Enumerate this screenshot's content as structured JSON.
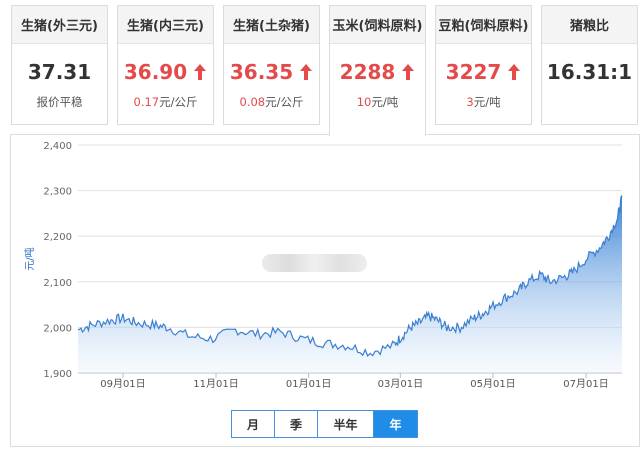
{
  "tabs": [
    {
      "title": "生猪(外三元)",
      "price": "37.31",
      "change": "",
      "unit": "报价平稳",
      "trend": "flat"
    },
    {
      "title": "生猪(内三元)",
      "price": "36.90",
      "change": "0.17",
      "unit": "元/公斤",
      "trend": "up"
    },
    {
      "title": "生猪(土杂猪)",
      "price": "36.35",
      "change": "0.08",
      "unit": "元/公斤",
      "trend": "up"
    },
    {
      "title": "玉米(饲料原料)",
      "price": "2288",
      "change": "10",
      "unit": "元/吨",
      "trend": "up"
    },
    {
      "title": "豆粕(饲料原料)",
      "price": "3227",
      "change": "3",
      "unit": "元/吨",
      "trend": "up"
    },
    {
      "title": "猪粮比",
      "price": "16.31:1",
      "change": "",
      "unit": "",
      "trend": "flat"
    }
  ],
  "active_tab": 3,
  "range_buttons": [
    "月",
    "季",
    "半年",
    "年"
  ],
  "active_range": 3,
  "colors": {
    "accent": "#1f8de8",
    "up": "#e34a4a",
    "line": "#3a7fd0"
  },
  "chart_data": {
    "type": "area",
    "ylabel": "元/吨",
    "ylim": [
      1900,
      2400
    ],
    "yticks": [
      "1,900",
      "2,000",
      "2,100",
      "2,200",
      "2,300",
      "2,400"
    ],
    "ytick_values": [
      1900,
      2000,
      2100,
      2200,
      2300,
      2400
    ],
    "xticks": [
      "09月01日",
      "11月01日",
      "01月01日",
      "03月01日",
      "05月01日",
      "07月01日"
    ],
    "xtick_positions": [
      0.1,
      0.307,
      0.513,
      0.717,
      0.923,
      1.13
    ],
    "grid": true,
    "series": [
      {
        "x": [
          0.0,
          0.03,
          0.07,
          0.1,
          0.13,
          0.17,
          0.2,
          0.25,
          0.3,
          0.35,
          0.4,
          0.45,
          0.5,
          0.55,
          0.6,
          0.65,
          0.7,
          0.72,
          0.74,
          0.76,
          0.78,
          0.8,
          0.82,
          0.85,
          0.88,
          0.9,
          0.92,
          0.95,
          0.98,
          1.0,
          1.03,
          1.05,
          1.08,
          1.1,
          1.13,
          1.16,
          1.18,
          1.2,
          1.21
        ],
        "values": [
          1995,
          2005,
          2015,
          2020,
          2010,
          2005,
          2000,
          1980,
          1975,
          1995,
          1985,
          1990,
          1975,
          1965,
          1960,
          1945,
          1960,
          1980,
          2000,
          2010,
          2025,
          2015,
          2000,
          2000,
          2020,
          2030,
          2045,
          2065,
          2080,
          2100,
          2115,
          2100,
          2110,
          2120,
          2150,
          2175,
          2200,
          2240,
          2285
        ]
      }
    ]
  }
}
